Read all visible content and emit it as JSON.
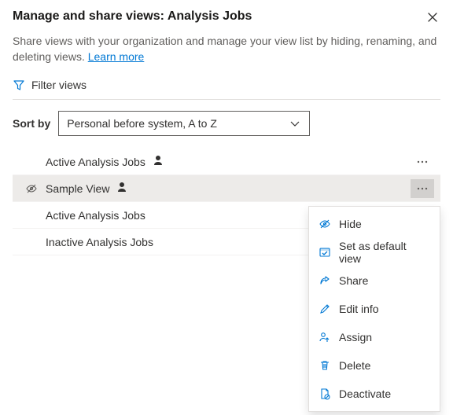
{
  "header": {
    "title": "Manage and share views: Analysis Jobs",
    "description_before": "Share views with your organization and manage your view list by hiding, renaming, and deleting views. ",
    "learn_more": "Learn more"
  },
  "filter_label": "Filter views",
  "sort": {
    "label": "Sort by",
    "selected": "Personal before system, A to Z"
  },
  "views": [
    {
      "label": "Active Analysis Jobs",
      "personal": true,
      "hidden": false,
      "selected": false,
      "show_more": true
    },
    {
      "label": "Sample View",
      "personal": true,
      "hidden": true,
      "selected": true,
      "show_more": true
    },
    {
      "label": "Active Analysis Jobs",
      "personal": false,
      "hidden": false,
      "selected": false,
      "show_more": false
    },
    {
      "label": "Inactive Analysis Jobs",
      "personal": false,
      "hidden": false,
      "selected": false,
      "show_more": false
    }
  ],
  "menu": {
    "items": [
      {
        "key": "hide",
        "label": "Hide"
      },
      {
        "key": "default",
        "label": "Set as default view"
      },
      {
        "key": "share",
        "label": "Share"
      },
      {
        "key": "edit",
        "label": "Edit info"
      },
      {
        "key": "assign",
        "label": "Assign"
      },
      {
        "key": "delete",
        "label": "Delete"
      },
      {
        "key": "deactivate",
        "label": "Deactivate"
      }
    ]
  }
}
